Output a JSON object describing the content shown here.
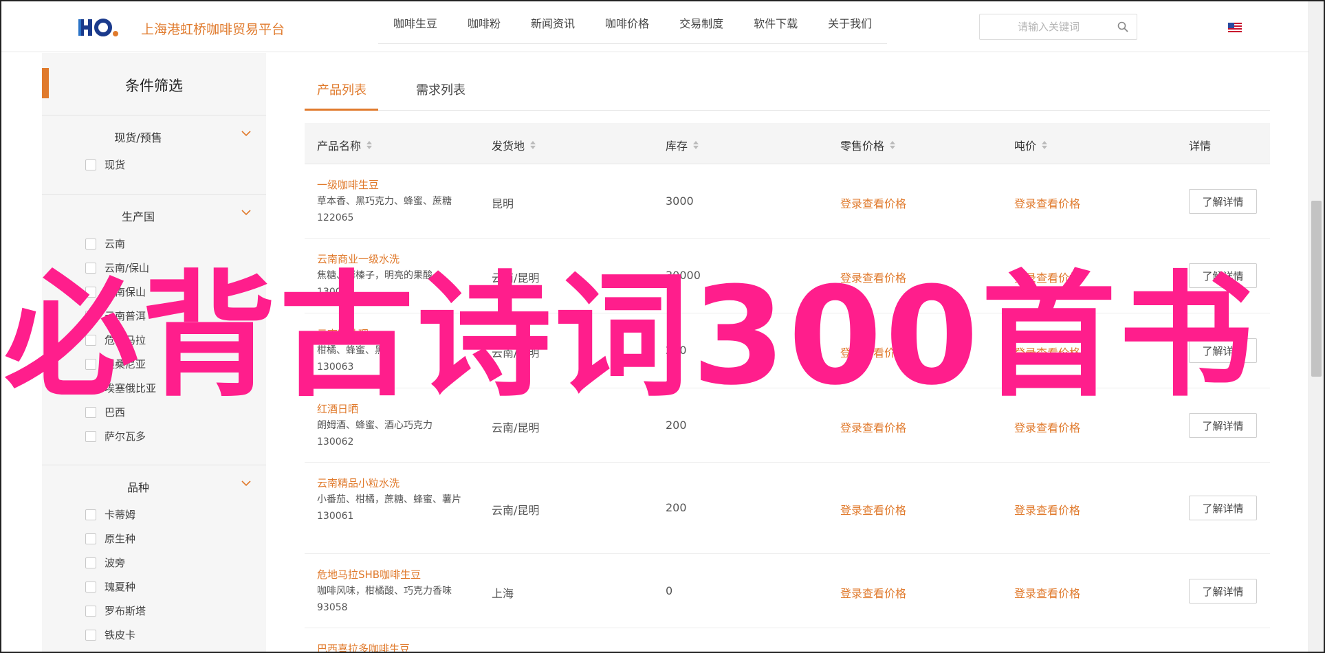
{
  "header": {
    "logo_text": "HO.",
    "site_title": "上海港虹桥咖啡贸易平台",
    "nav": [
      "咖啡生豆",
      "咖啡粉",
      "新闻资讯",
      "咖啡价格",
      "交易制度",
      "软件下载",
      "关于我们"
    ],
    "search_placeholder": "请输入关键词",
    "colors": {
      "accent": "#e07a2c"
    }
  },
  "sidebar": {
    "title": "条件筛选",
    "groups": [
      {
        "title": "现货/预售",
        "options": [
          "现货"
        ]
      },
      {
        "title": "生产国",
        "options": [
          "云南",
          "云南/保山",
          "云南保山",
          "云南普洱",
          "危地马拉",
          "坦桑尼亚",
          "埃塞俄比亚",
          "巴西",
          "萨尔瓦多"
        ]
      },
      {
        "title": "品种",
        "options": [
          "卡蒂姆",
          "原生种",
          "波旁",
          "瑰夏种",
          "罗布斯塔",
          "铁皮卡"
        ]
      }
    ]
  },
  "tabs": {
    "products": "产品列表",
    "demands": "需求列表"
  },
  "table": {
    "headers": {
      "name": "产品名称",
      "origin": "发货地",
      "stock": "库存",
      "retail": "零售价格",
      "ton": "吨价",
      "detail": "详情"
    },
    "rows": [
      {
        "name": "一级咖啡生豆",
        "desc": "草本香、黑巧克力、蜂蜜、蔗糖",
        "code": "122065",
        "origin": "昆明",
        "stock": "3000",
        "retail": "登录查看价格",
        "ton": "登录查看价格",
        "btn": "了解详情"
      },
      {
        "name": "云南商业一级水洗",
        "desc": "焦糖、烤榛子，明亮的果酸",
        "code": "130064",
        "origin": "云南/昆明",
        "stock": "30000",
        "retail": "登录查看价格",
        "ton": "登录查看价格",
        "btn": "了解详情"
      },
      {
        "name": "云南蜜处理",
        "desc": "柑橘、蜂蜜、黑糖",
        "code": "130063",
        "origin": "云南/昆明",
        "stock": "200",
        "retail": "登录查看价格",
        "ton": "登录查看价格",
        "btn": "了解详情"
      },
      {
        "name": "红酒日晒",
        "desc": "朗姆酒、蜂蜜、酒心巧克力",
        "code": "130062",
        "origin": "云南/昆明",
        "stock": "200",
        "retail": "登录查看价格",
        "ton": "登录查看价格",
        "btn": "了解详情"
      },
      {
        "name": "云南精品小粒水洗",
        "desc": "小番茄、柑橘，蔗糖、蜂蜜、薯片",
        "code": "130061",
        "origin": "云南/昆明",
        "stock": "200",
        "retail": "登录查看价格",
        "ton": "登录查看价格",
        "btn": "了解详情"
      },
      {
        "name": "危地马拉SHB咖啡生豆",
        "desc": "咖啡风味，柑橘酸、巧克力香味",
        "code": "93058",
        "origin": "上海",
        "stock": "0",
        "retail": "登录查看价格",
        "ton": "登录查看价格",
        "btn": "了解详情"
      },
      {
        "name": "巴西喜拉多咖啡生豆",
        "desc": "",
        "code": "",
        "origin": "",
        "stock": "",
        "retail": "",
        "ton": "",
        "btn": ""
      }
    ]
  },
  "overlay_text": "必背古诗词300首书"
}
